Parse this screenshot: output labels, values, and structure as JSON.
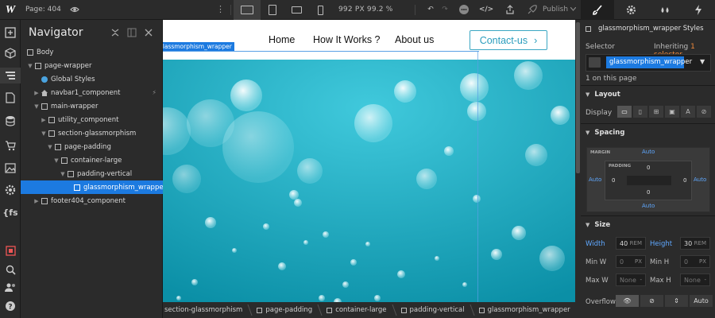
{
  "topbar": {
    "page_label": "Page: 404",
    "size_readout": "992 PX  99.2 %",
    "publish_label": "Publish"
  },
  "navigator": {
    "title": "Navigator",
    "items": [
      {
        "label": "Body",
        "depth": 0
      },
      {
        "label": "page-wrapper",
        "depth": 1
      },
      {
        "label": "Global Styles",
        "depth": 2
      },
      {
        "label": "navbar1_component",
        "depth": 2
      },
      {
        "label": "main-wrapper",
        "depth": 2
      },
      {
        "label": "utility_component",
        "depth": 3
      },
      {
        "label": "section-glassmorphism",
        "depth": 3
      },
      {
        "label": "page-padding",
        "depth": 4
      },
      {
        "label": "container-large",
        "depth": 5
      },
      {
        "label": "padding-vertical",
        "depth": 6
      },
      {
        "label": "glassmorphism_wrapper",
        "depth": 7
      },
      {
        "label": "footer404_component",
        "depth": 2
      }
    ]
  },
  "canvas": {
    "selected_tag": "glassmorphism_wrapper",
    "nav_links": [
      "Home",
      "How It Works ?",
      "About us"
    ],
    "cta_label": "Contact-us"
  },
  "breadcrumbs": [
    "section-glassmorphism",
    "page-padding",
    "container-large",
    "padding-vertical",
    "glassmorphism_wrapper"
  ],
  "style_panel": {
    "title": "glassmorphism_wrapper Styles",
    "selector_label": "Selector",
    "inheriting_label": "Inheriting",
    "inheriting_count": "1 selector",
    "selector_token": "glassmorphism_wrapper",
    "on_page": "1 on this page",
    "layout_title": "Layout",
    "display_label": "Display",
    "spacing_title": "Spacing",
    "margin_label": "MARGIN",
    "padding_label": "PADDING",
    "auto": "Auto",
    "zero": "0",
    "size_title": "Size",
    "width_label": "Width",
    "width_value": "40",
    "height_label": "Height",
    "height_value": "30",
    "rem": "REM",
    "px": "PX",
    "none": "None",
    "min_w_label": "Min W",
    "min_h_label": "Min H",
    "max_w_label": "Max W",
    "max_h_label": "Max H",
    "overflow_label": "Overflow",
    "overflow_auto": "Auto"
  },
  "colors": {
    "accent_blue": "#1c7ae0",
    "cta_teal": "#2a9dbd",
    "hero_cyan": "#1fa9c0",
    "inherit_orange": "#f08a3c"
  }
}
